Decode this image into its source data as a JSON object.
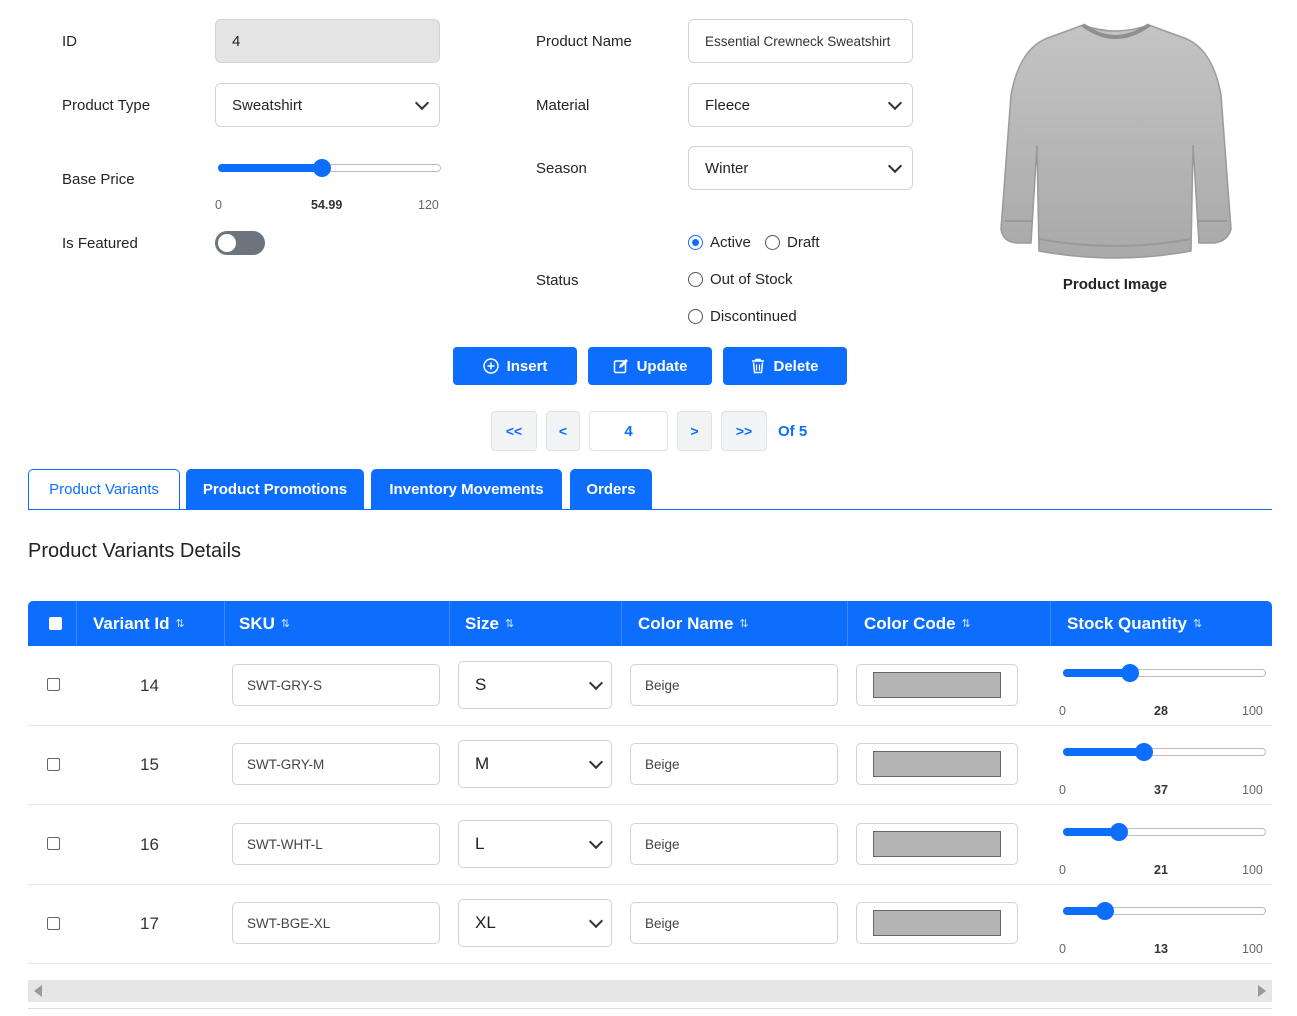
{
  "form": {
    "id_label": "ID",
    "id_value": "4",
    "product_type_label": "Product Type",
    "product_type_value": "Sweatshirt",
    "base_price_label": "Base Price",
    "base_price_min": "0",
    "base_price_value": "54.99",
    "base_price_max": "120",
    "is_featured_label": "Is Featured",
    "is_featured_on": false,
    "product_name_label": "Product Name",
    "product_name_value": "Essential Crewneck Sweatshirt",
    "material_label": "Material",
    "material_value": "Fleece",
    "season_label": "Season",
    "season_value": "Winter",
    "status_label": "Status",
    "status_options": [
      "Active",
      "Draft",
      "Out of Stock",
      "Discontinued"
    ],
    "status_selected": "Active",
    "image_caption": "Product Image"
  },
  "actions": {
    "insert": "Insert",
    "update": "Update",
    "delete": "Delete"
  },
  "pager": {
    "first": "<<",
    "prev": "<",
    "current": "4",
    "next": ">",
    "last": ">>",
    "of_text": "Of 5"
  },
  "tabs": [
    "Product Variants",
    "Product Promotions",
    "Inventory Movements",
    "Orders"
  ],
  "active_tab": "Product Variants",
  "section_title": "Product Variants Details",
  "table": {
    "columns": [
      "Variant Id",
      "SKU",
      "Size",
      "Color Name",
      "Color Code",
      "Stock Quantity"
    ],
    "sort_icon": "sort-icon",
    "rows": [
      {
        "variant_id": "14",
        "sku": "SWT-GRY-S",
        "size": "S",
        "color_name": "Beige",
        "color_code": "#b4b4b4",
        "stock_min": "0",
        "stock": "28",
        "stock_max": "100"
      },
      {
        "variant_id": "15",
        "sku": "SWT-GRY-M",
        "size": "M",
        "color_name": "Beige",
        "color_code": "#b4b4b4",
        "stock_min": "0",
        "stock": "37",
        "stock_max": "100"
      },
      {
        "variant_id": "16",
        "sku": "SWT-WHT-L",
        "size": "L",
        "color_name": "Beige",
        "color_code": "#b4b4b4",
        "stock_min": "0",
        "stock": "21",
        "stock_max": "100"
      },
      {
        "variant_id": "17",
        "sku": "SWT-BGE-XL",
        "size": "XL",
        "color_name": "Beige",
        "color_code": "#b4b4b4",
        "stock_min": "0",
        "stock": "13",
        "stock_max": "100"
      }
    ]
  },
  "colors": {
    "primary": "#0d6efd",
    "toggle_off": "#6c757d"
  }
}
